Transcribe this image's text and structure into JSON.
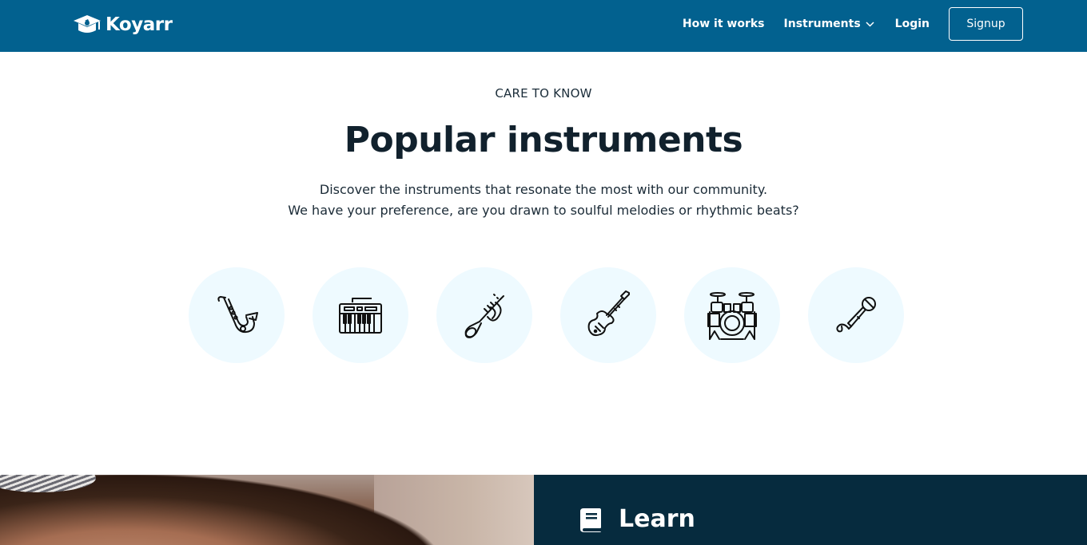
{
  "header": {
    "brand": "Koyarr",
    "nav": {
      "how_it_works": "How it works",
      "instruments": "Instruments",
      "login": "Login",
      "signup": "Signup"
    },
    "background_color": "#02618f"
  },
  "popular": {
    "eyebrow": "CARE TO KNOW",
    "title": "Popular instruments",
    "description_line1": "Discover the instruments that resonate the most with our community.",
    "description_line2": "We have your preference, are you drawn to soulful melodies or rhythmic beats?",
    "instruments": [
      {
        "icon": "saxophone-icon"
      },
      {
        "icon": "keyboard-icon"
      },
      {
        "icon": "trumpet-icon"
      },
      {
        "icon": "guitar-icon"
      },
      {
        "icon": "drums-icon"
      },
      {
        "icon": "microphone-icon"
      }
    ],
    "circle_color": "#eefaff"
  },
  "learn": {
    "title": "Learn",
    "panel_color": "#062b3e"
  }
}
